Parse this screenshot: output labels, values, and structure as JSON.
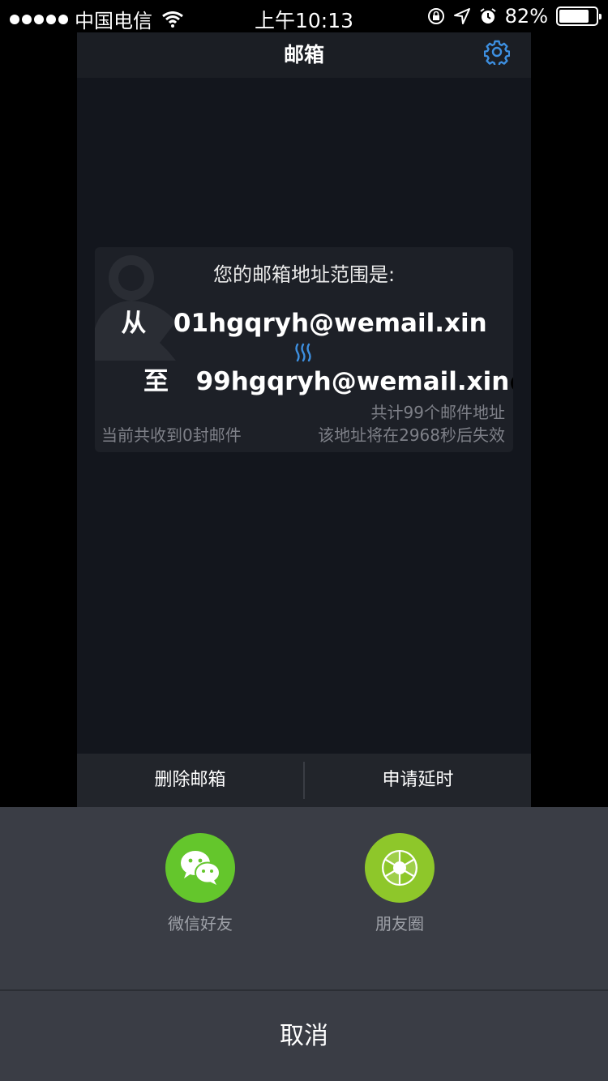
{
  "status_bar": {
    "carrier": "中国电信",
    "time": "上午10:13",
    "battery_percent": "82%",
    "battery_level": 0.82
  },
  "nav": {
    "title": "邮箱",
    "settings_icon": "gear-icon"
  },
  "card": {
    "title": "您的邮箱地址范围是:",
    "from_label": "从",
    "from_address": "01hgqryh@wemail.xin",
    "to_label": "至",
    "to_address": "99hgqryh@wemail.xin",
    "help_icon": "?",
    "total": "共计99个邮件地址",
    "received": "当前共收到0封邮件",
    "expire": "该地址将在2968秒后失效"
  },
  "bottom_bar": {
    "delete_label": "删除邮箱",
    "extend_label": "申请延时"
  },
  "share_sheet": {
    "items": [
      {
        "label": "微信好友",
        "icon": "wechat-icon",
        "color": "#64c62c"
      },
      {
        "label": "朋友圈",
        "icon": "moments-icon",
        "color": "#8ec72a"
      }
    ],
    "cancel_label": "取消"
  },
  "colors": {
    "accent": "#3d8fe0",
    "sheet_bg": "#3a3d45"
  }
}
